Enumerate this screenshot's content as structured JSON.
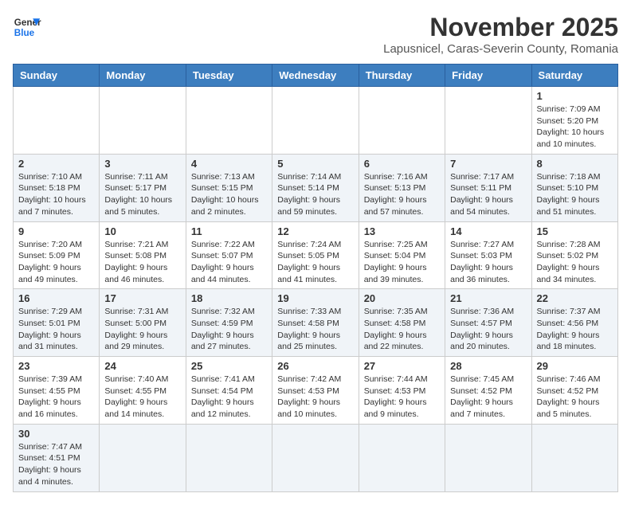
{
  "header": {
    "logo_line1": "General",
    "logo_line2": "Blue",
    "month": "November 2025",
    "location": "Lapusnicel, Caras-Severin County, Romania"
  },
  "weekdays": [
    "Sunday",
    "Monday",
    "Tuesday",
    "Wednesday",
    "Thursday",
    "Friday",
    "Saturday"
  ],
  "weeks": [
    [
      {
        "day": "",
        "info": ""
      },
      {
        "day": "",
        "info": ""
      },
      {
        "day": "",
        "info": ""
      },
      {
        "day": "",
        "info": ""
      },
      {
        "day": "",
        "info": ""
      },
      {
        "day": "",
        "info": ""
      },
      {
        "day": "1",
        "info": "Sunrise: 7:09 AM\nSunset: 5:20 PM\nDaylight: 10 hours and 10 minutes."
      }
    ],
    [
      {
        "day": "2",
        "info": "Sunrise: 7:10 AM\nSunset: 5:18 PM\nDaylight: 10 hours and 7 minutes."
      },
      {
        "day": "3",
        "info": "Sunrise: 7:11 AM\nSunset: 5:17 PM\nDaylight: 10 hours and 5 minutes."
      },
      {
        "day": "4",
        "info": "Sunrise: 7:13 AM\nSunset: 5:15 PM\nDaylight: 10 hours and 2 minutes."
      },
      {
        "day": "5",
        "info": "Sunrise: 7:14 AM\nSunset: 5:14 PM\nDaylight: 9 hours and 59 minutes."
      },
      {
        "day": "6",
        "info": "Sunrise: 7:16 AM\nSunset: 5:13 PM\nDaylight: 9 hours and 57 minutes."
      },
      {
        "day": "7",
        "info": "Sunrise: 7:17 AM\nSunset: 5:11 PM\nDaylight: 9 hours and 54 minutes."
      },
      {
        "day": "8",
        "info": "Sunrise: 7:18 AM\nSunset: 5:10 PM\nDaylight: 9 hours and 51 minutes."
      }
    ],
    [
      {
        "day": "9",
        "info": "Sunrise: 7:20 AM\nSunset: 5:09 PM\nDaylight: 9 hours and 49 minutes."
      },
      {
        "day": "10",
        "info": "Sunrise: 7:21 AM\nSunset: 5:08 PM\nDaylight: 9 hours and 46 minutes."
      },
      {
        "day": "11",
        "info": "Sunrise: 7:22 AM\nSunset: 5:07 PM\nDaylight: 9 hours and 44 minutes."
      },
      {
        "day": "12",
        "info": "Sunrise: 7:24 AM\nSunset: 5:05 PM\nDaylight: 9 hours and 41 minutes."
      },
      {
        "day": "13",
        "info": "Sunrise: 7:25 AM\nSunset: 5:04 PM\nDaylight: 9 hours and 39 minutes."
      },
      {
        "day": "14",
        "info": "Sunrise: 7:27 AM\nSunset: 5:03 PM\nDaylight: 9 hours and 36 minutes."
      },
      {
        "day": "15",
        "info": "Sunrise: 7:28 AM\nSunset: 5:02 PM\nDaylight: 9 hours and 34 minutes."
      }
    ],
    [
      {
        "day": "16",
        "info": "Sunrise: 7:29 AM\nSunset: 5:01 PM\nDaylight: 9 hours and 31 minutes."
      },
      {
        "day": "17",
        "info": "Sunrise: 7:31 AM\nSunset: 5:00 PM\nDaylight: 9 hours and 29 minutes."
      },
      {
        "day": "18",
        "info": "Sunrise: 7:32 AM\nSunset: 4:59 PM\nDaylight: 9 hours and 27 minutes."
      },
      {
        "day": "19",
        "info": "Sunrise: 7:33 AM\nSunset: 4:58 PM\nDaylight: 9 hours and 25 minutes."
      },
      {
        "day": "20",
        "info": "Sunrise: 7:35 AM\nSunset: 4:58 PM\nDaylight: 9 hours and 22 minutes."
      },
      {
        "day": "21",
        "info": "Sunrise: 7:36 AM\nSunset: 4:57 PM\nDaylight: 9 hours and 20 minutes."
      },
      {
        "day": "22",
        "info": "Sunrise: 7:37 AM\nSunset: 4:56 PM\nDaylight: 9 hours and 18 minutes."
      }
    ],
    [
      {
        "day": "23",
        "info": "Sunrise: 7:39 AM\nSunset: 4:55 PM\nDaylight: 9 hours and 16 minutes."
      },
      {
        "day": "24",
        "info": "Sunrise: 7:40 AM\nSunset: 4:55 PM\nDaylight: 9 hours and 14 minutes."
      },
      {
        "day": "25",
        "info": "Sunrise: 7:41 AM\nSunset: 4:54 PM\nDaylight: 9 hours and 12 minutes."
      },
      {
        "day": "26",
        "info": "Sunrise: 7:42 AM\nSunset: 4:53 PM\nDaylight: 9 hours and 10 minutes."
      },
      {
        "day": "27",
        "info": "Sunrise: 7:44 AM\nSunset: 4:53 PM\nDaylight: 9 hours and 9 minutes."
      },
      {
        "day": "28",
        "info": "Sunrise: 7:45 AM\nSunset: 4:52 PM\nDaylight: 9 hours and 7 minutes."
      },
      {
        "day": "29",
        "info": "Sunrise: 7:46 AM\nSunset: 4:52 PM\nDaylight: 9 hours and 5 minutes."
      }
    ],
    [
      {
        "day": "30",
        "info": "Sunrise: 7:47 AM\nSunset: 4:51 PM\nDaylight: 9 hours and 4 minutes."
      },
      {
        "day": "",
        "info": ""
      },
      {
        "day": "",
        "info": ""
      },
      {
        "day": "",
        "info": ""
      },
      {
        "day": "",
        "info": ""
      },
      {
        "day": "",
        "info": ""
      },
      {
        "day": "",
        "info": ""
      }
    ]
  ]
}
